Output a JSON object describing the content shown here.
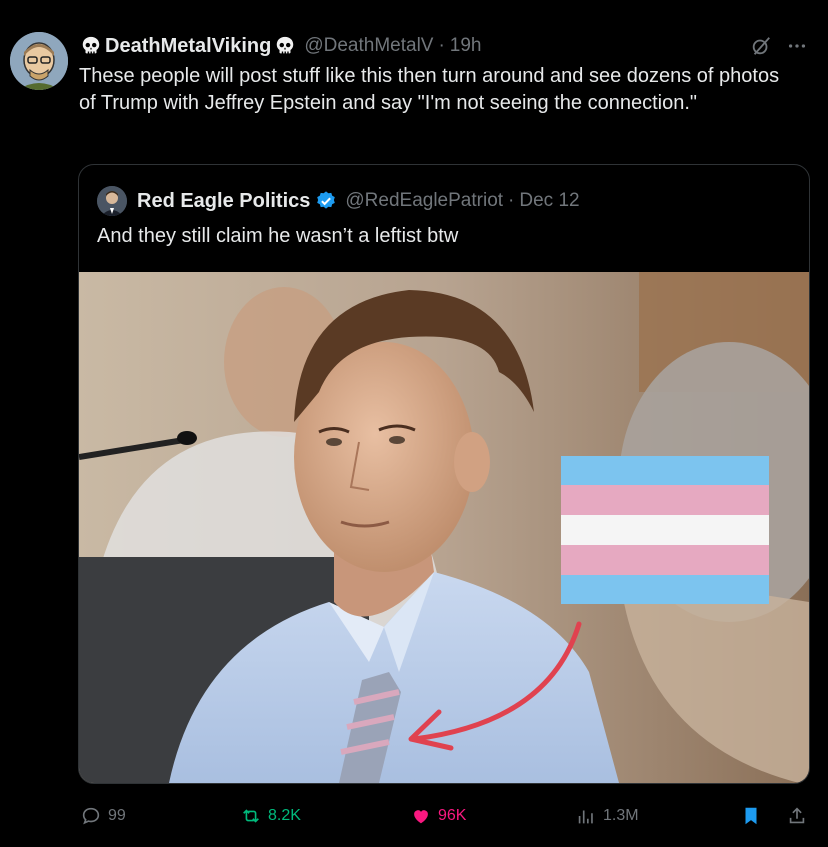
{
  "tweet": {
    "display_name": "DeathMetalViking",
    "handle": "@DeathMetalV",
    "time": "19h",
    "separator": "·",
    "text": "These people will post stuff like this then turn around and see dozens of photos of Trump with Jeffrey Epstein and say \"I'm not seeing the connection.\""
  },
  "quoted": {
    "display_name": "Red Eagle Politics",
    "handle": "@RedEaglePatriot",
    "time": "Dec 12",
    "separator": "·",
    "text": "And they still claim he wasn’t a leftist btw",
    "flag_colors": [
      "#7cc4ef",
      "#e6a9c1",
      "#f5f5f5",
      "#e6a9c1",
      "#7cc4ef"
    ],
    "arrow_color": "#e0424f"
  },
  "actions": {
    "replies": "99",
    "reposts": "8.2K",
    "likes": "96K",
    "views": "1.3M"
  },
  "colors": {
    "background": "#000000",
    "text": "#e7e9ea",
    "muted": "#71767b",
    "repost_green": "#00ba7c",
    "like_pink": "#f91880",
    "bookmark_blue": "#1d9bf0",
    "verified_blue": "#1d9bf0"
  },
  "icons": [
    "skull-icon",
    "verified-badge-icon",
    "grok-icon",
    "more-icon",
    "reply-icon",
    "repost-icon",
    "like-icon",
    "views-icon",
    "bookmark-icon",
    "share-icon"
  ]
}
